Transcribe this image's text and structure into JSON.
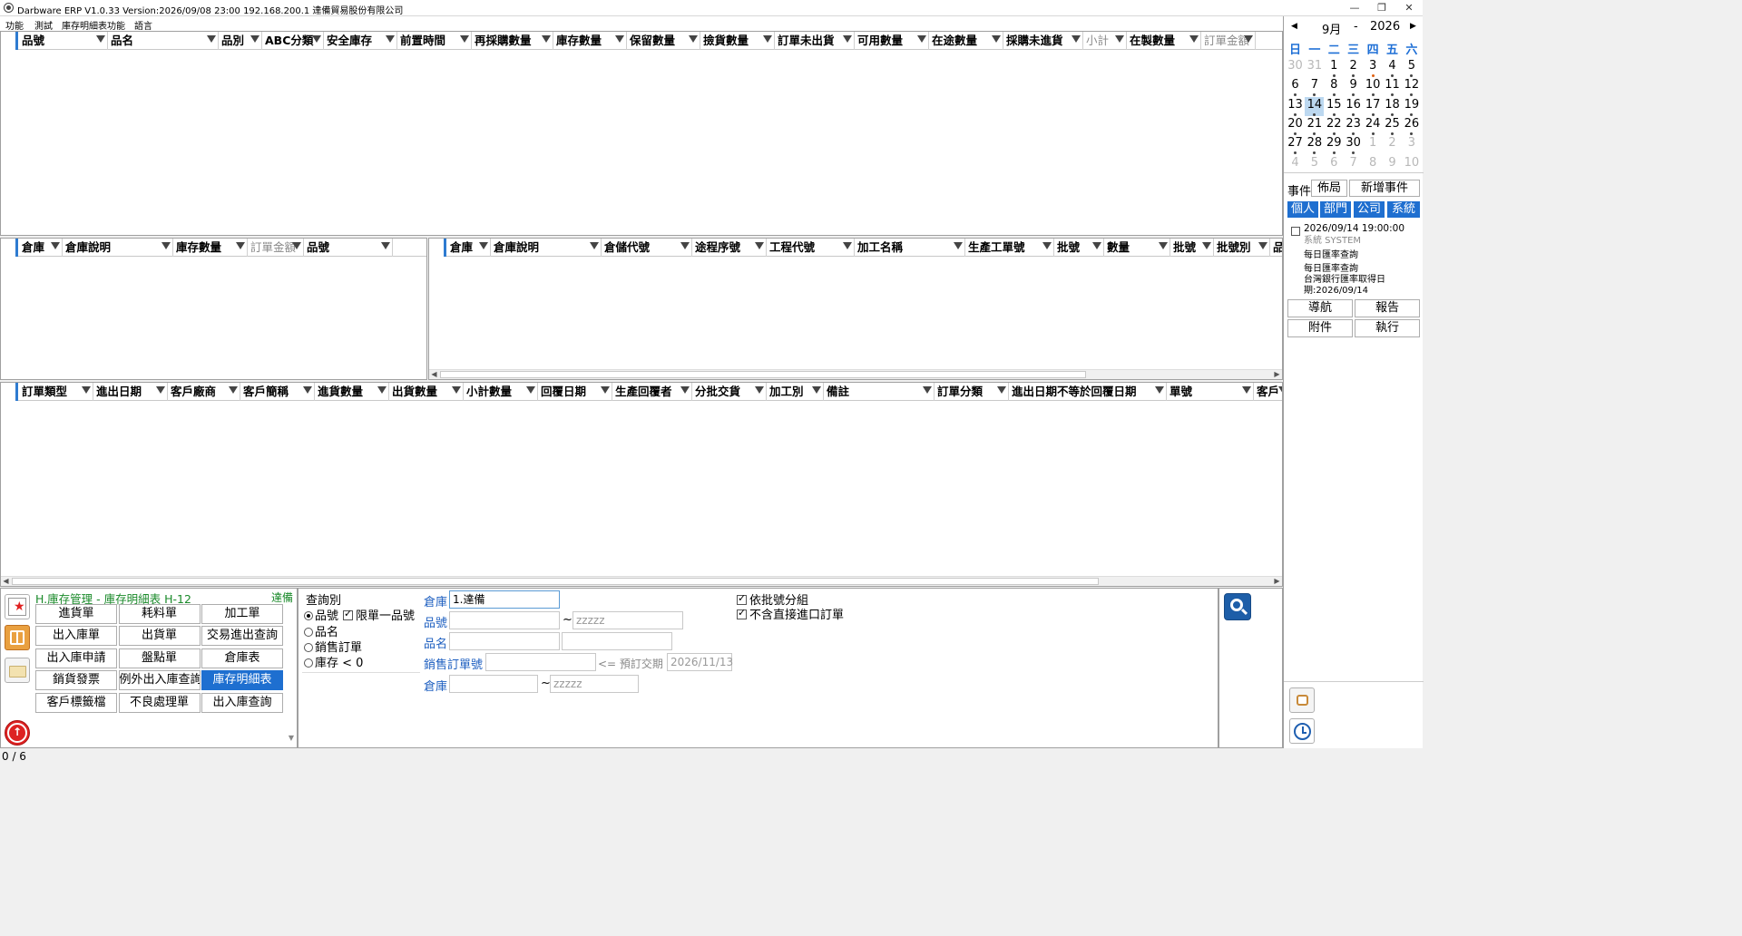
{
  "window": {
    "title": "Darbware ERP V1.0.33 Version:2026/09/08 23:00   192.168.200.1 達備貿易股份有限公司"
  },
  "menu": [
    "功能",
    "測試",
    "庫存明細表功能",
    "語言"
  ],
  "grid_top": {
    "columns": [
      {
        "label": "品號",
        "w": 98
      },
      {
        "label": "品名",
        "w": 122
      },
      {
        "label": "品別",
        "w": 48
      },
      {
        "label": "ABC分類",
        "w": 68
      },
      {
        "label": "安全庫存",
        "w": 81
      },
      {
        "label": "前置時間",
        "w": 82
      },
      {
        "label": "再採購數量",
        "w": 90
      },
      {
        "label": "庫存數量",
        "w": 81
      },
      {
        "label": "保留數量",
        "w": 81
      },
      {
        "label": "撿貨數量",
        "w": 82
      },
      {
        "label": "訂單未出貨",
        "w": 88
      },
      {
        "label": "可用數量",
        "w": 82
      },
      {
        "label": "在途數量",
        "w": 82
      },
      {
        "label": "採購未進貨",
        "w": 88
      },
      {
        "label": "小計",
        "w": 48,
        "dim": true
      },
      {
        "label": "在製數量",
        "w": 82
      },
      {
        "label": "訂單金額",
        "w": 60,
        "dim": true
      }
    ]
  },
  "grid_mid_left": {
    "columns": [
      {
        "label": "倉庫",
        "w": 48
      },
      {
        "label": "倉庫說明",
        "w": 122
      },
      {
        "label": "庫存數量",
        "w": 82
      },
      {
        "label": "訂單金額",
        "w": 62,
        "dim": true
      },
      {
        "label": "品號",
        "w": 98
      }
    ]
  },
  "grid_mid_right": {
    "columns": [
      {
        "label": "倉庫",
        "w": 48
      },
      {
        "label": "倉庫說明",
        "w": 122
      },
      {
        "label": "倉儲代號",
        "w": 100
      },
      {
        "label": "途程序號",
        "w": 82
      },
      {
        "label": "工程代號",
        "w": 97
      },
      {
        "label": "加工名稱",
        "w": 122
      },
      {
        "label": "生產工單號",
        "w": 98
      },
      {
        "label": "批號",
        "w": 55
      },
      {
        "label": "數量",
        "w": 73
      },
      {
        "label": "批號",
        "w": 48
      },
      {
        "label": "批號別",
        "w": 62
      },
      {
        "label": "品",
        "w": 30
      }
    ]
  },
  "grid_bottom": {
    "columns": [
      {
        "label": "訂單類型",
        "w": 82
      },
      {
        "label": "進出日期",
        "w": 82
      },
      {
        "label": "客戶廠商",
        "w": 80
      },
      {
        "label": "客戶簡稱",
        "w": 82
      },
      {
        "label": "進貨數量",
        "w": 82
      },
      {
        "label": "出貨數量",
        "w": 82
      },
      {
        "label": "小計數量",
        "w": 82
      },
      {
        "label": "回覆日期",
        "w": 82
      },
      {
        "label": "生產回覆者",
        "w": 88
      },
      {
        "label": "分批交貨",
        "w": 82
      },
      {
        "label": "加工別",
        "w": 63
      },
      {
        "label": "備註",
        "w": 122
      },
      {
        "label": "訂單分類",
        "w": 82
      },
      {
        "label": "進出日期不等於回覆日期",
        "w": 174
      },
      {
        "label": "單號",
        "w": 96
      },
      {
        "label": "客戶",
        "w": 40
      }
    ]
  },
  "calendar": {
    "month": "9月",
    "sep": "-",
    "year": "2026",
    "dow": [
      "日",
      "一",
      "二",
      "三",
      "四",
      "五",
      "六"
    ],
    "days": [
      [
        "30",
        "31",
        "1",
        "2",
        "3",
        "4",
        "5"
      ],
      [
        "6",
        "7",
        "8",
        "9",
        "10",
        "11",
        "12"
      ],
      [
        "13",
        "14",
        "15",
        "16",
        "17",
        "18",
        "19"
      ],
      [
        "20",
        "21",
        "22",
        "23",
        "24",
        "25",
        "26"
      ],
      [
        "27",
        "28",
        "29",
        "30",
        "1",
        "2",
        "3"
      ],
      [
        "4",
        "5",
        "6",
        "7",
        "8",
        "9",
        "10"
      ]
    ],
    "selected": "14"
  },
  "side": {
    "event_label": "事件",
    "layout_btn": "佈局",
    "add_event_btn": "新增事件",
    "tabs": [
      "個人",
      "部門",
      "公司",
      "系統"
    ],
    "event": {
      "datetime": "2026/09/14 19:00:00",
      "owner": "系統  SYSTEM",
      "line1": "每日匯率查詢",
      "line2": "每日匯率查詢",
      "line3": "台灣銀行匯率取得日",
      "line4": "期:2026/09/14"
    },
    "nav_btn": "導航",
    "report_btn": "報告",
    "attach_btn": "附件",
    "exec_btn": "執行"
  },
  "module": {
    "title": "H.庫存管理 - 庫存明細表  H-12",
    "company": "達備",
    "buttons": [
      "進貨單",
      "耗料單",
      "加工單",
      "出入庫單",
      "出貨單",
      "交易進出查詢",
      "出入庫申請",
      "盤點單",
      "倉庫表",
      "銷貨發票",
      "例外出入庫查詢",
      "庫存明細表",
      "客戶標籤檔",
      "不良處理單",
      "出入庫查詢"
    ],
    "active": "庫存明細表"
  },
  "query": {
    "group_label": "查詢別",
    "opt_item": "品號",
    "single_item": "限單一品號",
    "opt_name": "品名",
    "opt_so": "銷售訂單",
    "opt_stock": "庫存 < 0",
    "warehouse_label": "倉庫",
    "warehouse_value": "1.達備",
    "item_label": "品號",
    "item_to_placeholder": "zzzzz",
    "name_label": "品名",
    "so_label": "銷售訂單號",
    "so_hint": "<= 預訂交期",
    "so_date": "2026/11/13",
    "wh2_label": "倉庫",
    "wh2_to_placeholder": "zzzzz",
    "tilde": "~",
    "group_by_lot": "依批號分組",
    "exclude_direct": "不含直接進口訂單"
  },
  "status": {
    "text": "0 / 6"
  }
}
